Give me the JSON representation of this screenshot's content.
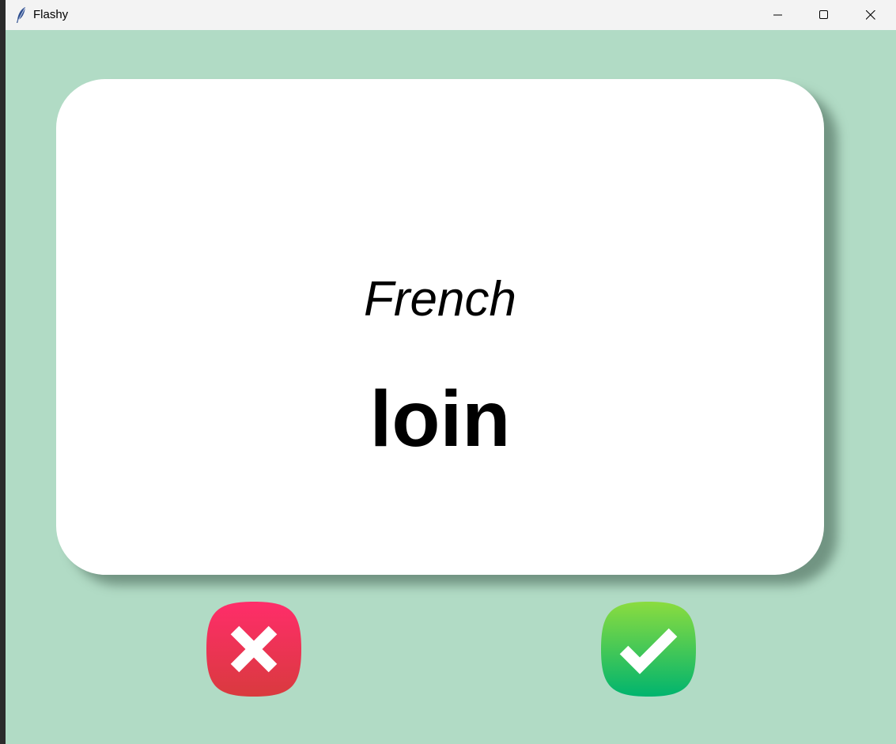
{
  "window": {
    "title": "Flashy",
    "background_color": "#b1dbc5",
    "icon": "feather-icon"
  },
  "controls": {
    "minimize_icon": "minimize-icon",
    "maximize_icon": "maximize-icon",
    "close_icon": "close-icon"
  },
  "card": {
    "language": "French",
    "word": "loin",
    "background_color": "#ffffff"
  },
  "buttons": {
    "wrong": {
      "icon": "x-mark-icon",
      "color_top": "#ff2d6a",
      "color_bottom": "#d93a3e"
    },
    "right": {
      "icon": "checkmark-icon",
      "color_top": "#8bdc3f",
      "color_bottom": "#00b46e"
    }
  }
}
